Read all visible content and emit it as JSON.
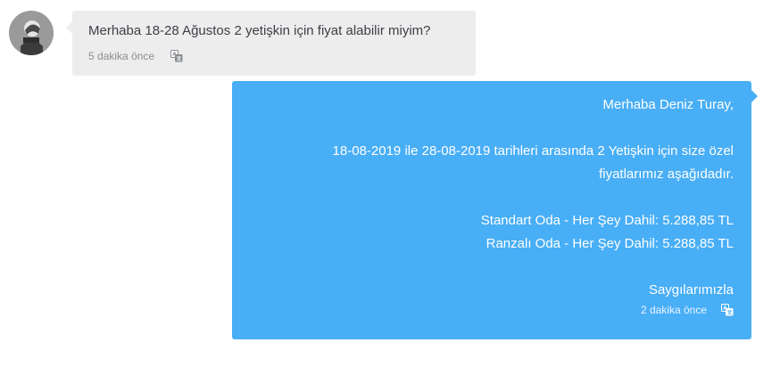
{
  "incoming": {
    "text": "Merhaba 18-28 Ağustos 2 yetişkin için fiyat alabilir miyim?",
    "time": "5 dakika önce",
    "avatar_icon": "user-avatar-photo",
    "translate_icon": "translate-icon",
    "bubble_color": "#ededee"
  },
  "outgoing": {
    "lines": [
      "Merhaba Deniz Turay,",
      "",
      "18-08-2019 ile 28-08-2019 tarihleri arasında 2 Yetişkin için size özel",
      "fiyatlarımız aşağıdadır.",
      "",
      "Standart Oda - Her Şey Dahil: 5.288,85 TL",
      "Ranzalı Oda - Her Şey Dahil: 5.288,85 TL",
      "",
      "Saygılarımızla"
    ],
    "time": "2 dakika önce",
    "translate_icon": "translate-icon",
    "bubble_color": "#48aef6"
  }
}
